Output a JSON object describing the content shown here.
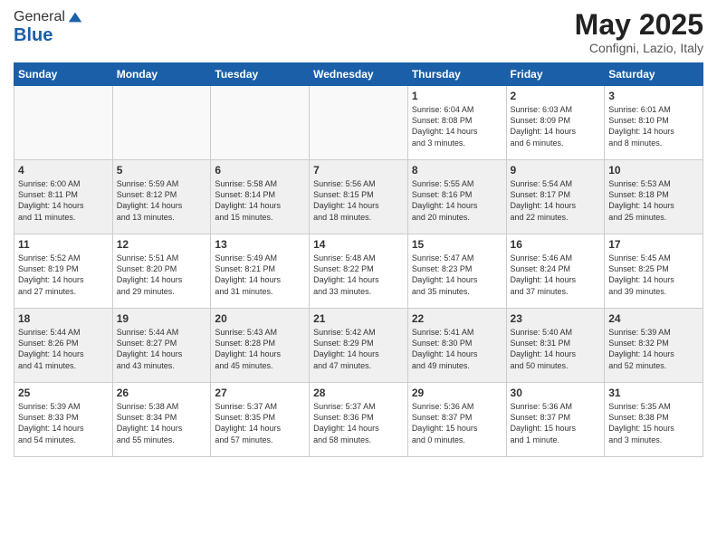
{
  "header": {
    "logo_general": "General",
    "logo_blue": "Blue",
    "month": "May 2025",
    "location": "Configni, Lazio, Italy"
  },
  "days_of_week": [
    "Sunday",
    "Monday",
    "Tuesday",
    "Wednesday",
    "Thursday",
    "Friday",
    "Saturday"
  ],
  "weeks": [
    [
      {
        "day": "",
        "content": ""
      },
      {
        "day": "",
        "content": ""
      },
      {
        "day": "",
        "content": ""
      },
      {
        "day": "",
        "content": ""
      },
      {
        "day": "1",
        "content": "Sunrise: 6:04 AM\nSunset: 8:08 PM\nDaylight: 14 hours\nand 3 minutes."
      },
      {
        "day": "2",
        "content": "Sunrise: 6:03 AM\nSunset: 8:09 PM\nDaylight: 14 hours\nand 6 minutes."
      },
      {
        "day": "3",
        "content": "Sunrise: 6:01 AM\nSunset: 8:10 PM\nDaylight: 14 hours\nand 8 minutes."
      }
    ],
    [
      {
        "day": "4",
        "content": "Sunrise: 6:00 AM\nSunset: 8:11 PM\nDaylight: 14 hours\nand 11 minutes."
      },
      {
        "day": "5",
        "content": "Sunrise: 5:59 AM\nSunset: 8:12 PM\nDaylight: 14 hours\nand 13 minutes."
      },
      {
        "day": "6",
        "content": "Sunrise: 5:58 AM\nSunset: 8:14 PM\nDaylight: 14 hours\nand 15 minutes."
      },
      {
        "day": "7",
        "content": "Sunrise: 5:56 AM\nSunset: 8:15 PM\nDaylight: 14 hours\nand 18 minutes."
      },
      {
        "day": "8",
        "content": "Sunrise: 5:55 AM\nSunset: 8:16 PM\nDaylight: 14 hours\nand 20 minutes."
      },
      {
        "day": "9",
        "content": "Sunrise: 5:54 AM\nSunset: 8:17 PM\nDaylight: 14 hours\nand 22 minutes."
      },
      {
        "day": "10",
        "content": "Sunrise: 5:53 AM\nSunset: 8:18 PM\nDaylight: 14 hours\nand 25 minutes."
      }
    ],
    [
      {
        "day": "11",
        "content": "Sunrise: 5:52 AM\nSunset: 8:19 PM\nDaylight: 14 hours\nand 27 minutes."
      },
      {
        "day": "12",
        "content": "Sunrise: 5:51 AM\nSunset: 8:20 PM\nDaylight: 14 hours\nand 29 minutes."
      },
      {
        "day": "13",
        "content": "Sunrise: 5:49 AM\nSunset: 8:21 PM\nDaylight: 14 hours\nand 31 minutes."
      },
      {
        "day": "14",
        "content": "Sunrise: 5:48 AM\nSunset: 8:22 PM\nDaylight: 14 hours\nand 33 minutes."
      },
      {
        "day": "15",
        "content": "Sunrise: 5:47 AM\nSunset: 8:23 PM\nDaylight: 14 hours\nand 35 minutes."
      },
      {
        "day": "16",
        "content": "Sunrise: 5:46 AM\nSunset: 8:24 PM\nDaylight: 14 hours\nand 37 minutes."
      },
      {
        "day": "17",
        "content": "Sunrise: 5:45 AM\nSunset: 8:25 PM\nDaylight: 14 hours\nand 39 minutes."
      }
    ],
    [
      {
        "day": "18",
        "content": "Sunrise: 5:44 AM\nSunset: 8:26 PM\nDaylight: 14 hours\nand 41 minutes."
      },
      {
        "day": "19",
        "content": "Sunrise: 5:44 AM\nSunset: 8:27 PM\nDaylight: 14 hours\nand 43 minutes."
      },
      {
        "day": "20",
        "content": "Sunrise: 5:43 AM\nSunset: 8:28 PM\nDaylight: 14 hours\nand 45 minutes."
      },
      {
        "day": "21",
        "content": "Sunrise: 5:42 AM\nSunset: 8:29 PM\nDaylight: 14 hours\nand 47 minutes."
      },
      {
        "day": "22",
        "content": "Sunrise: 5:41 AM\nSunset: 8:30 PM\nDaylight: 14 hours\nand 49 minutes."
      },
      {
        "day": "23",
        "content": "Sunrise: 5:40 AM\nSunset: 8:31 PM\nDaylight: 14 hours\nand 50 minutes."
      },
      {
        "day": "24",
        "content": "Sunrise: 5:39 AM\nSunset: 8:32 PM\nDaylight: 14 hours\nand 52 minutes."
      }
    ],
    [
      {
        "day": "25",
        "content": "Sunrise: 5:39 AM\nSunset: 8:33 PM\nDaylight: 14 hours\nand 54 minutes."
      },
      {
        "day": "26",
        "content": "Sunrise: 5:38 AM\nSunset: 8:34 PM\nDaylight: 14 hours\nand 55 minutes."
      },
      {
        "day": "27",
        "content": "Sunrise: 5:37 AM\nSunset: 8:35 PM\nDaylight: 14 hours\nand 57 minutes."
      },
      {
        "day": "28",
        "content": "Sunrise: 5:37 AM\nSunset: 8:36 PM\nDaylight: 14 hours\nand 58 minutes."
      },
      {
        "day": "29",
        "content": "Sunrise: 5:36 AM\nSunset: 8:37 PM\nDaylight: 15 hours\nand 0 minutes."
      },
      {
        "day": "30",
        "content": "Sunrise: 5:36 AM\nSunset: 8:37 PM\nDaylight: 15 hours\nand 1 minute."
      },
      {
        "day": "31",
        "content": "Sunrise: 5:35 AM\nSunset: 8:38 PM\nDaylight: 15 hours\nand 3 minutes."
      }
    ]
  ]
}
